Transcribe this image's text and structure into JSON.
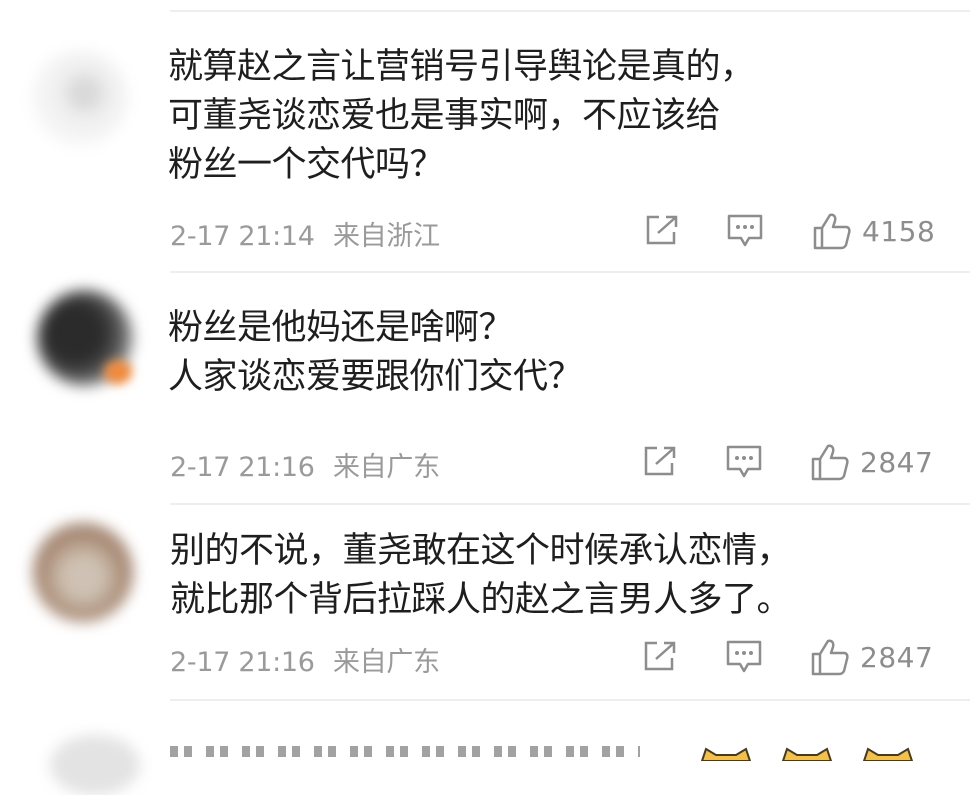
{
  "comments": [
    {
      "lines": [
        "就算赵之言让营销号引导舆论是真的，",
        "可董尧谈恋爱也是事实啊，不应该给",
        "粉丝一个交代吗？"
      ],
      "date": "2-17 21:14",
      "location": "来自浙江",
      "likes": "4158"
    },
    {
      "lines": [
        "粉丝是他妈还是啥啊？",
        "人家谈恋爱要跟你们交代？"
      ],
      "date": "2-17 21:16",
      "location": "来自广东",
      "likes": "2847"
    },
    {
      "lines": [
        "别的不说，董尧敢在这个时候承认恋情，",
        "就比那个背后拉踩人的赵之言男人多了。"
      ],
      "date": "2-17 21:16",
      "location": "来自广东",
      "likes": "2847"
    }
  ],
  "icons": {
    "share": "share-icon",
    "comment": "comment-icon",
    "like": "thumbs-up-icon",
    "emoji": "cat-emoji-icon"
  },
  "colors": {
    "text": "#1e1e1e",
    "meta": "#9a9a9a",
    "icon": "#8d8d8d",
    "divider": "#eeeeee"
  }
}
